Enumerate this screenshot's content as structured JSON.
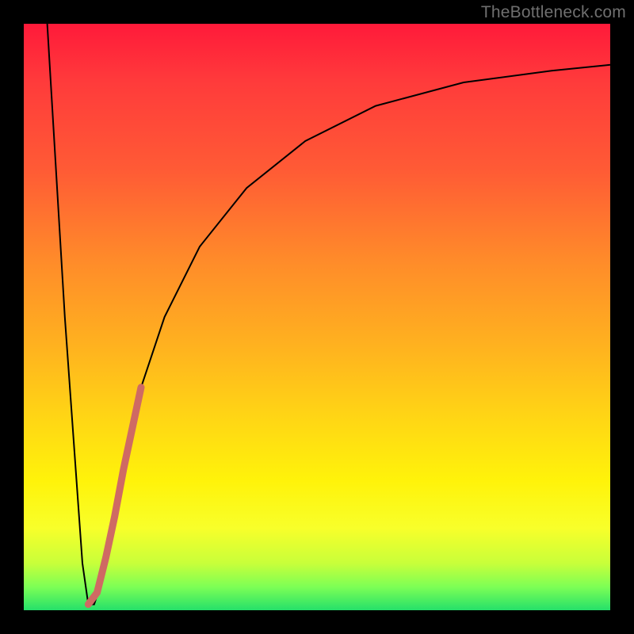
{
  "watermark": {
    "text": "TheBottleneck.com"
  },
  "chart_data": {
    "type": "line",
    "title": "",
    "xlabel": "",
    "ylabel": "",
    "xlim": [
      0,
      100
    ],
    "ylim": [
      0,
      100
    ],
    "grid": false,
    "legend": false,
    "background_gradient_stops": [
      {
        "pct": 0,
        "color": "#ff1a3a"
      },
      {
        "pct": 10,
        "color": "#ff3b3b"
      },
      {
        "pct": 25,
        "color": "#ff5b35"
      },
      {
        "pct": 40,
        "color": "#ff8a2a"
      },
      {
        "pct": 55,
        "color": "#ffb21f"
      },
      {
        "pct": 68,
        "color": "#ffd814"
      },
      {
        "pct": 78,
        "color": "#fff30a"
      },
      {
        "pct": 86,
        "color": "#f8ff2a"
      },
      {
        "pct": 92,
        "color": "#c8ff3a"
      },
      {
        "pct": 96,
        "color": "#7dff55"
      },
      {
        "pct": 100,
        "color": "#25e06a"
      }
    ],
    "series": [
      {
        "name": "bottleneck-curve",
        "color": "#000000",
        "width": 2,
        "x": [
          4,
          7,
          10,
          11,
          12,
          13,
          14,
          16,
          18,
          20,
          24,
          30,
          38,
          48,
          60,
          75,
          90,
          100
        ],
        "y": [
          100,
          50,
          8,
          1,
          1,
          4,
          10,
          20,
          30,
          38,
          50,
          62,
          72,
          80,
          86,
          90,
          92,
          93
        ]
      },
      {
        "name": "highlight-segment",
        "color": "#cf6a63",
        "width": 9,
        "linecap": "round",
        "x": [
          11.0,
          12.5,
          14.0,
          15.5,
          17.0,
          18.5,
          20.0
        ],
        "y": [
          1.0,
          3.0,
          9.0,
          16.0,
          24.0,
          31.0,
          38.0
        ]
      }
    ]
  }
}
